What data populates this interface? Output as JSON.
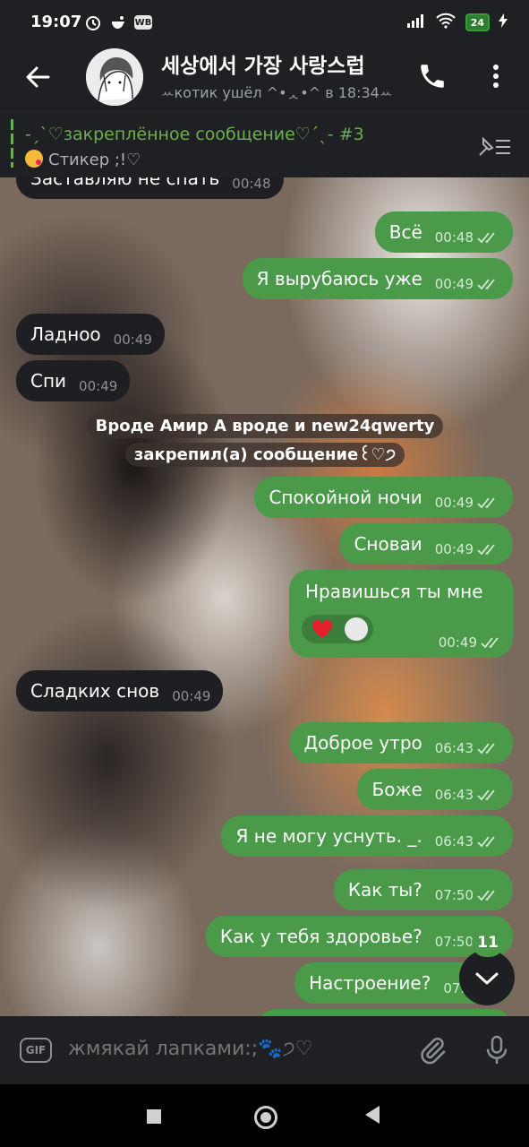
{
  "status_bar": {
    "time": "19:07",
    "battery": "24"
  },
  "header": {
    "title": "세상에서 가장 사랑스럽",
    "subtitle": "ꕀкотик ушёл ^•ᆺ•^ в 18:34ꕀ"
  },
  "pinned": {
    "title": "-ˏˋ♡закреплённое сообщение♡ˊˎ- #3",
    "preview": "Стикер ;!♡"
  },
  "messages": [
    {
      "text": "Заставляю не спать",
      "time": "00:48",
      "direction": "in"
    },
    {
      "text": "Всё",
      "time": "00:48",
      "direction": "out"
    },
    {
      "text": "Я вырубаюсь уже",
      "time": "00:49",
      "direction": "out"
    },
    {
      "text": "Ладноо",
      "time": "00:49",
      "direction": "in"
    },
    {
      "text": "Спи",
      "time": "00:49",
      "direction": "in"
    },
    {
      "text": "Спокойной ночи",
      "time": "00:49",
      "direction": "out"
    },
    {
      "text": "Сноваи",
      "time": "00:49",
      "direction": "out"
    },
    {
      "text": "Нравишься ты мне",
      "time": "00:49",
      "direction": "out"
    },
    {
      "text": "Сладких снов",
      "time": "00:49",
      "direction": "in"
    },
    {
      "text": "Доброе утро",
      "time": "06:43",
      "direction": "out"
    },
    {
      "text": "Боже",
      "time": "06:43",
      "direction": "out"
    },
    {
      "text": "Я не могу уснуть. _.",
      "time": "06:43",
      "direction": "out"
    },
    {
      "text": "Как ты?",
      "time": "07:50",
      "direction": "out"
    },
    {
      "text": "Как у тебя здоровье?",
      "time": "07:50",
      "direction": "out"
    },
    {
      "text": "Настроение?",
      "time": "07:5",
      "direction": "out"
    }
  ],
  "service_message": "Вроде Амир А вроде и new24qwerty закрепил(а) сообщение꒰♡੭",
  "unread_badge": "11",
  "input": {
    "placeholder": "жмякай лапками:;🐾੭♡",
    "gif_label": "GIF"
  },
  "colors": {
    "outgoing_bubble": "#4a9a4a",
    "incoming_bubble": "#1d1f22",
    "accent": "#6ab04c"
  }
}
